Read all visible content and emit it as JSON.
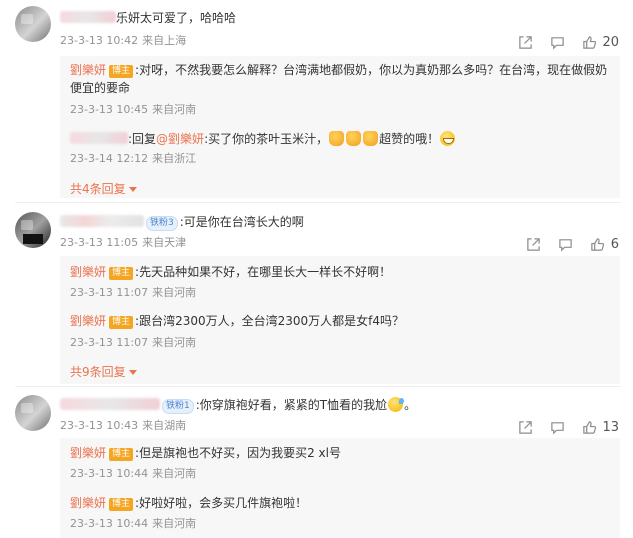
{
  "comments": [
    {
      "text": "乐妍太可爱了，哈哈哈",
      "date": "23-3-13 10:42",
      "location": "来自上海",
      "likes": "20",
      "replies": [
        {
          "name": "劉樂妍",
          "badge": "博主",
          "text1": ":对呀，不然我要怎么解释？台湾满地都假奶，你以为真奶那么多吗？在台湾，现在做假奶",
          "text2": "便宜的要命",
          "date": "23-3-13 10:45",
          "location": "来自河南"
        },
        {
          "prefix": ":回复",
          "at": "@劉樂妍",
          "text": ":买了你的茶叶玉米汁，",
          "text_after": "超赞的哦！",
          "date": "23-3-14 12:12",
          "location": "来自浙江"
        }
      ],
      "more": "共4条回复"
    },
    {
      "fans_badge": "铁粉3",
      "text": ":可是你在台湾长大的啊",
      "date": "23-3-13 11:05",
      "location": "来自天津",
      "likes": "6",
      "replies": [
        {
          "name": "劉樂妍",
          "badge": "博主",
          "text": ":先天品种如果不好，在哪里长大一样长不好啊！",
          "date": "23-3-13 11:07",
          "location": "来自河南"
        },
        {
          "name": "劉樂妍",
          "badge": "博主",
          "text": ":跟台湾2300万人，全台湾2300万人都是女f4吗？",
          "date": "23-3-13 11:07",
          "location": "来自河南"
        }
      ],
      "more": "共9条回复"
    },
    {
      "fans_badge": "铁粉1",
      "text": ":你穿旗袍好看，紧紧的T恤看的我尬",
      "text_end": "。",
      "date": "23-3-13 10:43",
      "location": "来自湖南",
      "likes": "13",
      "replies": [
        {
          "name": "劉樂妍",
          "badge": "博主",
          "text": ":但是旗袍也不好买，因为我要买2 xl号",
          "date": "23-3-13 10:44",
          "location": "来自河南"
        },
        {
          "name": "劉樂妍",
          "badge": "博主",
          "text": ":好啦好啦，会多买几件旗袍啦！",
          "date": "23-3-13 10:44",
          "location": "来自河南"
        }
      ]
    }
  ],
  "icons": {
    "share": "share-icon",
    "comment": "comment-icon",
    "like": "thumbs-up-icon",
    "thumb_emoji": "thumbs-up-emoji-icon",
    "grin_emoji": "grin-emoji-icon",
    "sweat_emoji": "sweat-smile-emoji-icon"
  },
  "colors": {
    "accent": "#eb7350",
    "meta": "#939393",
    "badge": "#f4a623",
    "fans_badge": "#4c84d3",
    "reply_bg": "#f7f7f7"
  }
}
